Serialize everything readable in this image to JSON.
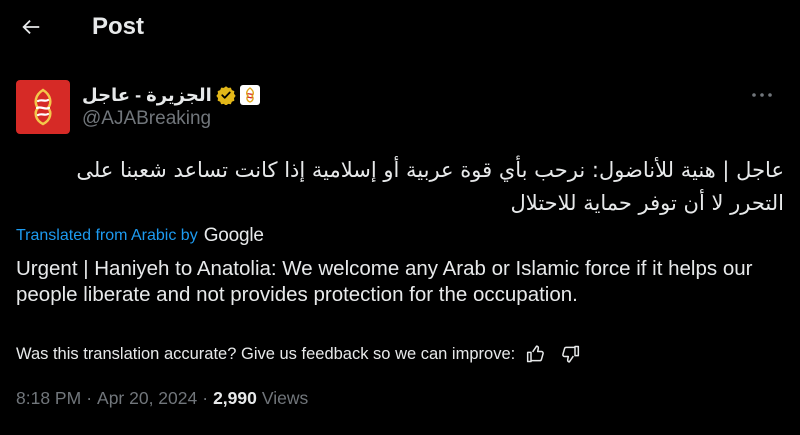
{
  "header": {
    "title": "Post",
    "back_icon": "arrow-left-icon"
  },
  "author": {
    "display_name": "الجزيرة - عاجل",
    "handle": "@AJABreaking",
    "verified_color": "#e2b719",
    "avatar_color": "#d62a26"
  },
  "tweet": {
    "text": "عاجل | هنية للأناضول: نرحب بأي قوة عربية أو إسلامية إذا كانت تساعد شعبنا على التحرر لا أن توفر حماية للاحتلال"
  },
  "translation": {
    "label": "Translated from Arabic by",
    "provider": "Google",
    "text": "Urgent | Haniyeh to Anatolia: We welcome any Arab or Islamic force if it helps our people liberate and not provides protection for the occupation.",
    "feedback_prompt": "Was this translation accurate? Give us feedback so we can improve:"
  },
  "meta": {
    "time": "8:18 PM",
    "date": "Apr 20, 2024",
    "separator": "·",
    "views_count": "2,990",
    "views_label": "Views"
  },
  "colors": {
    "background": "#000000",
    "text": "#e7e9ea",
    "muted": "#71767b",
    "link": "#1d9bf0"
  }
}
